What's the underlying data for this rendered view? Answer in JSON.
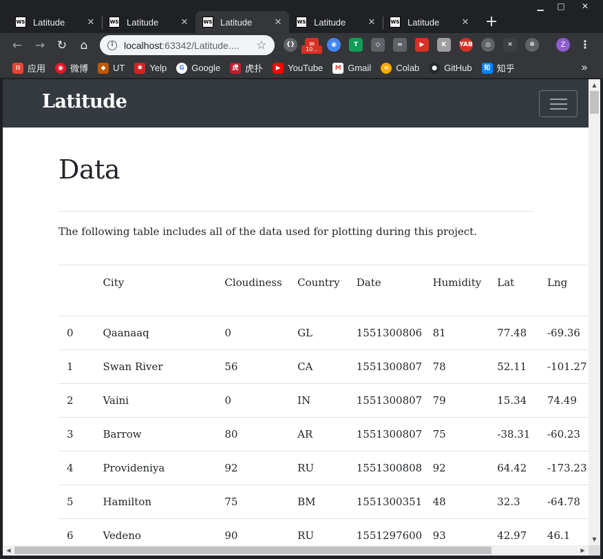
{
  "window": {
    "minimize": "▁",
    "maximize": "□",
    "close": "✕"
  },
  "tabs": [
    {
      "title": "Latitude",
      "icon": "WS",
      "active": false
    },
    {
      "title": "Latitude",
      "icon": "WS",
      "active": false
    },
    {
      "title": "Latitude",
      "icon": "WS",
      "active": true
    },
    {
      "title": "Latitude",
      "icon": "WS",
      "active": false
    },
    {
      "title": "Latitude",
      "icon": "WS",
      "active": false
    }
  ],
  "toolbar": {
    "url_host": "localhost",
    "url_rest": ":63342/Latitude....",
    "extension_badge": "10...",
    "profile_initial": "Z"
  },
  "bookmarks": [
    {
      "label": "应用",
      "icon": "apps-grid-icon",
      "color": "#ea4335"
    },
    {
      "label": "微博",
      "icon": "weibo-icon",
      "color": "#e6162d"
    },
    {
      "label": "UT",
      "icon": "ut-shield-icon",
      "color": "#bf5700"
    },
    {
      "label": "Yelp",
      "icon": "yelp-icon",
      "color": "#d32323"
    },
    {
      "label": "Google",
      "icon": "google-icon",
      "color": "#4285f4"
    },
    {
      "label": "虎扑",
      "icon": "hupu-icon",
      "color": "#c01e2f"
    },
    {
      "label": "YouTube",
      "icon": "youtube-icon",
      "color": "#ff0000"
    },
    {
      "label": "Gmail",
      "icon": "gmail-icon",
      "color": "#ea4335"
    },
    {
      "label": "Colab",
      "icon": "colab-icon",
      "color": "#f9ab00"
    },
    {
      "label": "GitHub",
      "icon": "github-icon",
      "color": "#24292e"
    },
    {
      "label": "知乎",
      "icon": "zhihu-icon",
      "color": "#0084ff"
    }
  ],
  "bookmarks_more": "»",
  "navbar": {
    "brand": "Latitude"
  },
  "page": {
    "title": "Data",
    "intro": "The following table includes all of the data used for plotting during this project."
  },
  "table": {
    "columns": [
      "",
      "City",
      "Cloudiness",
      "Country",
      "Date",
      "Humidity",
      "Lat",
      "Lng"
    ],
    "rows": [
      [
        "0",
        "Qaanaaq",
        "0",
        "GL",
        "1551300806",
        "81",
        "77.48",
        "-69.36"
      ],
      [
        "1",
        "Swan River",
        "56",
        "CA",
        "1551300807",
        "78",
        "52.11",
        "-101.27"
      ],
      [
        "2",
        "Vaini",
        "0",
        "IN",
        "1551300807",
        "79",
        "15.34",
        "74.49"
      ],
      [
        "3",
        "Barrow",
        "80",
        "AR",
        "1551300807",
        "75",
        "-38.31",
        "-60.23"
      ],
      [
        "4",
        "Provideniya",
        "92",
        "RU",
        "1551300808",
        "92",
        "64.42",
        "-173.23"
      ],
      [
        "5",
        "Hamilton",
        "75",
        "BM",
        "1551300351",
        "48",
        "32.3",
        "-64.78"
      ],
      [
        "6",
        "Vedeno",
        "90",
        "RU",
        "1551297600",
        "93",
        "42.97",
        "46.1"
      ]
    ]
  }
}
